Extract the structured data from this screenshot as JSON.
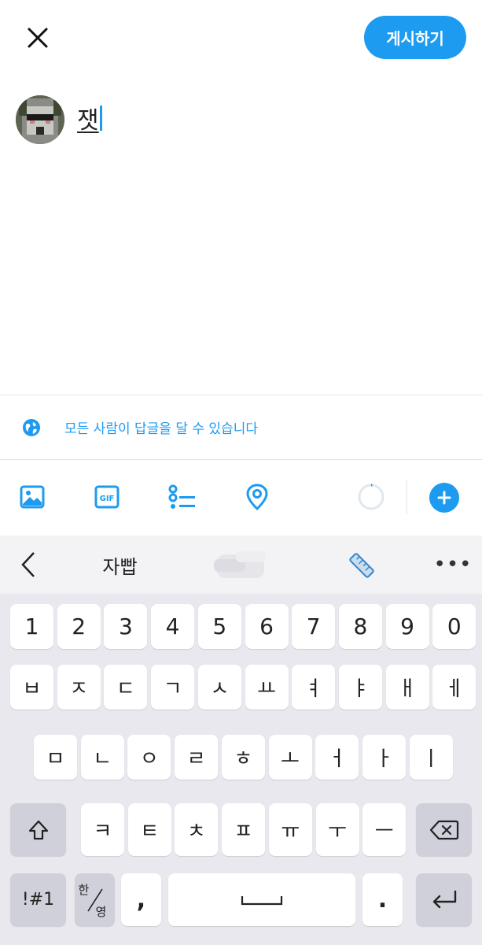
{
  "header": {
    "post_label": "게시하기"
  },
  "compose": {
    "text": "잿"
  },
  "reply_setting": {
    "label": "모든 사람이 답글을 달 수 있습니다"
  },
  "toolbar": {
    "icons": [
      "image-icon",
      "gif-icon",
      "poll-icon",
      "location-icon"
    ],
    "gif_label": "GIF"
  },
  "keyboard": {
    "suggestion": "자빱",
    "more_label": "•••",
    "number_row": [
      "1",
      "2",
      "3",
      "4",
      "5",
      "6",
      "7",
      "8",
      "9",
      "0"
    ],
    "row1": [
      "ㅂ",
      "ㅈ",
      "ㄷ",
      "ㄱ",
      "ㅅ",
      "ㅛ",
      "ㅕ",
      "ㅑ",
      "ㅐ",
      "ㅔ"
    ],
    "row2": [
      "ㅁ",
      "ㄴ",
      "ㅇ",
      "ㄹ",
      "ㅎ",
      "ㅗ",
      "ㅓ",
      "ㅏ",
      "ㅣ"
    ],
    "row3": [
      "ㅋ",
      "ㅌ",
      "ㅊ",
      "ㅍ",
      "ㅠ",
      "ㅜ",
      "ㅡ"
    ],
    "symbols_label": "!#1",
    "lang_top": "한",
    "lang_bottom": "영",
    "comma": ",",
    "period": "."
  },
  "colors": {
    "accent": "#1d9bf0",
    "keyboard_bg": "#e8e8ee"
  }
}
